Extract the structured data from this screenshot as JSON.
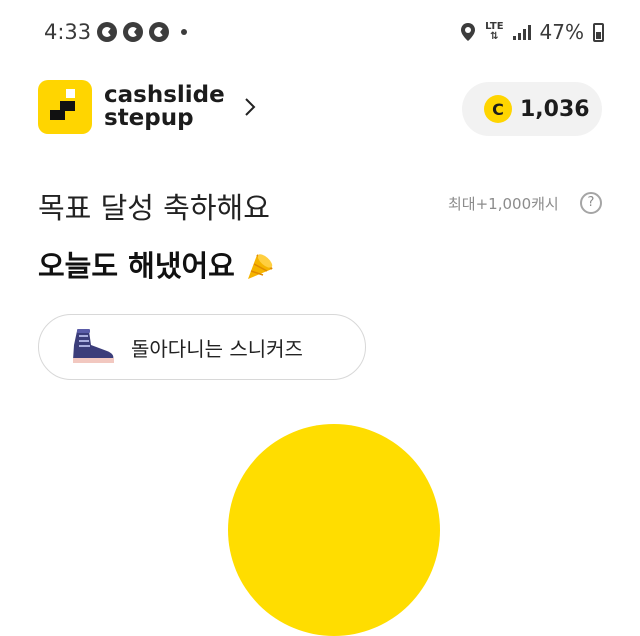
{
  "status_bar": {
    "time": "4:33",
    "network": "LTE",
    "battery": "47%"
  },
  "header": {
    "brand_line1": "cashslide",
    "brand_line2": "stepup"
  },
  "coins": {
    "symbol": "C",
    "value": "1,036"
  },
  "goal": {
    "title": "목표 달성 축하해요",
    "max_reward": "최대+1,000캐시",
    "help_symbol": "?",
    "done_text": "오늘도 해냈어요"
  },
  "item": {
    "label": "돌아다니는 스니커즈"
  },
  "colors": {
    "accent": "#ffd500",
    "pill_bg": "#f2f2f2"
  }
}
